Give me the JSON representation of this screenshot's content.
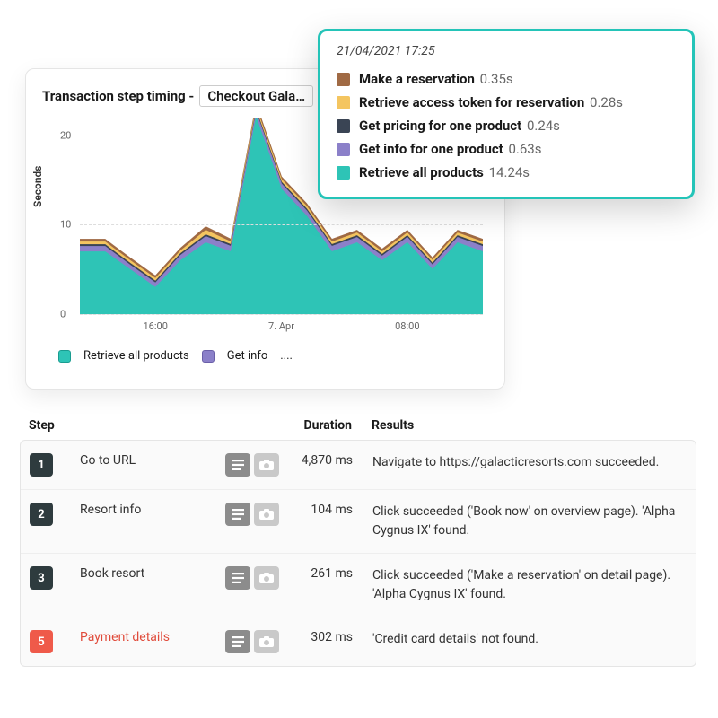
{
  "card": {
    "title_prefix": "Transaction step timing -",
    "select_value": "Checkout Gala…",
    "ylabel": "Seconds"
  },
  "chart_data": {
    "type": "area",
    "ylabel": "Seconds",
    "ylim": [
      0,
      22
    ],
    "yticks": [
      0,
      10,
      20
    ],
    "x": [
      0,
      1,
      2,
      3,
      4,
      5,
      6,
      7,
      8,
      9,
      10,
      11,
      12,
      13,
      14,
      15,
      16
    ],
    "xticks": [
      {
        "pos": 3,
        "label": "16:00"
      },
      {
        "pos": 8,
        "label": "7. Apr"
      },
      {
        "pos": 13,
        "label": "08:00"
      }
    ],
    "series": [
      {
        "name": "Retrieve all products",
        "color": "#2ec4b6",
        "values": [
          7,
          7,
          5,
          3,
          6,
          8,
          7,
          22,
          14,
          11,
          7,
          8,
          6,
          8,
          5,
          8,
          7
        ]
      },
      {
        "name": "Get info for one product",
        "color": "#8b80c9",
        "values": [
          0.6,
          0.6,
          0.5,
          0.5,
          0.6,
          0.7,
          0.6,
          0.6,
          0.6,
          0.6,
          0.6,
          0.6,
          0.5,
          0.6,
          0.5,
          0.6,
          0.6
        ]
      },
      {
        "name": "Get pricing for one product",
        "color": "#3a4454",
        "values": [
          0.2,
          0.2,
          0.2,
          0.2,
          0.2,
          0.2,
          0.2,
          0.2,
          0.2,
          0.2,
          0.2,
          0.2,
          0.2,
          0.2,
          0.2,
          0.2,
          0.2
        ]
      },
      {
        "name": "Retrieve access token for reservation",
        "color": "#f4c560",
        "values": [
          0.3,
          0.3,
          0.3,
          0.3,
          0.3,
          0.5,
          0.3,
          0.3,
          0.3,
          0.3,
          0.3,
          0.3,
          0.3,
          0.3,
          0.3,
          0.3,
          0.3
        ]
      },
      {
        "name": "Make a reservation",
        "color": "#a06a44",
        "values": [
          0.3,
          0.3,
          0.3,
          0.3,
          0.3,
          0.4,
          0.3,
          0.4,
          0.3,
          0.3,
          0.3,
          0.3,
          0.3,
          0.3,
          0.3,
          0.3,
          0.3
        ]
      }
    ]
  },
  "legend": {
    "item1": "Retrieve all products",
    "item2": "Get info",
    "more": "...."
  },
  "tooltip": {
    "timestamp": "21/04/2021 17:25",
    "rows": [
      {
        "color": "#a06a44",
        "name": "Make a reservation",
        "value": "0.35s"
      },
      {
        "color": "#f4c560",
        "name": "Retrieve access token for reservation",
        "value": "0.28s"
      },
      {
        "color": "#3a4454",
        "name": "Get pricing for one product",
        "value": "0.24s"
      },
      {
        "color": "#8b80c9",
        "name": "Get info for one product",
        "value": "0.63s"
      },
      {
        "color": "#2ec4b6",
        "name": "Retrieve all products",
        "value": "14.24s"
      }
    ]
  },
  "table": {
    "headers": {
      "step": "Step",
      "duration": "Duration",
      "results": "Results"
    },
    "rows": [
      {
        "num": "1",
        "err": false,
        "name": "Go to URL",
        "duration": "4,870 ms",
        "result": "Navigate to https://galacticresorts.com succeeded."
      },
      {
        "num": "2",
        "err": false,
        "name": "Resort info",
        "duration": "104 ms",
        "result": "Click succeeded ('Book now' on overview page). 'Alpha Cygnus IX' found."
      },
      {
        "num": "3",
        "err": false,
        "name": "Book resort",
        "duration": "261 ms",
        "result": "Click succeeded ('Make a reservation' on detail page). 'Alpha Cygnus IX' found."
      },
      {
        "num": "5",
        "err": true,
        "name": "Payment details",
        "duration": "302 ms",
        "result": "'Credit card details' not found."
      }
    ]
  }
}
